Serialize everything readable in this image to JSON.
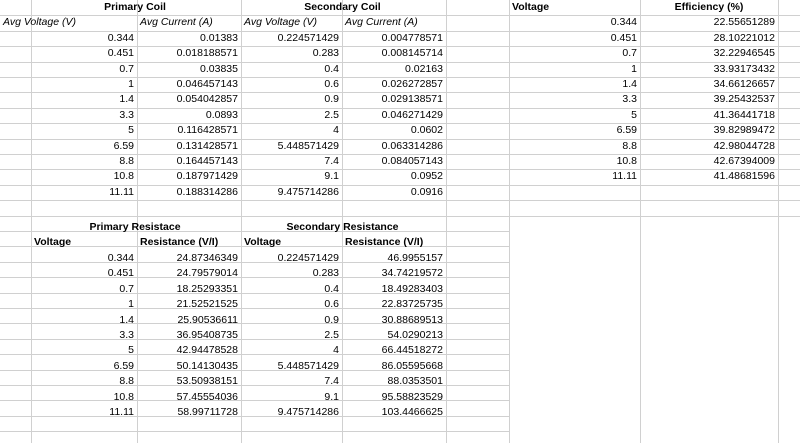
{
  "primary_coil": {
    "title": "Primary Coil",
    "col_voltage": "Avg Voltage (V)",
    "col_current": "Avg Current (A)",
    "rows": [
      [
        "0.344",
        "0.01383"
      ],
      [
        "0.451",
        "0.018188571"
      ],
      [
        "0.7",
        "0.03835"
      ],
      [
        "1",
        "0.046457143"
      ],
      [
        "1.4",
        "0.054042857"
      ],
      [
        "3.3",
        "0.0893"
      ],
      [
        "5",
        "0.116428571"
      ],
      [
        "6.59",
        "0.131428571"
      ],
      [
        "8.8",
        "0.164457143"
      ],
      [
        "10.8",
        "0.187971429"
      ],
      [
        "11.11",
        "0.188314286"
      ]
    ]
  },
  "secondary_coil": {
    "title": "Secondary Coil",
    "col_voltage": "Avg Voltage (V)",
    "col_current": "Avg Current (A)",
    "rows": [
      [
        "0.224571429",
        "0.004778571"
      ],
      [
        "0.283",
        "0.008145714"
      ],
      [
        "0.4",
        "0.02163"
      ],
      [
        "0.6",
        "0.026272857"
      ],
      [
        "0.9",
        "0.029138571"
      ],
      [
        "2.5",
        "0.046271429"
      ],
      [
        "4",
        "0.0602"
      ],
      [
        "5.448571429",
        "0.063314286"
      ],
      [
        "7.4",
        "0.084057143"
      ],
      [
        "9.1",
        "0.0952"
      ],
      [
        "9.475714286",
        "0.0916"
      ]
    ]
  },
  "efficiency": {
    "col_voltage": "Voltage",
    "col_efficiency": "Efficiency (%)",
    "rows": [
      [
        "0.344",
        "22.55651289"
      ],
      [
        "0.451",
        "28.10221012"
      ],
      [
        "0.7",
        "32.22946545"
      ],
      [
        "1",
        "33.93173432"
      ],
      [
        "1.4",
        "34.66126657"
      ],
      [
        "3.3",
        "39.25432537"
      ],
      [
        "5",
        "41.36441718"
      ],
      [
        "6.59",
        "39.82989472"
      ],
      [
        "8.8",
        "42.98044728"
      ],
      [
        "10.8",
        "42.67394009"
      ],
      [
        "11.11",
        "41.48681596"
      ]
    ]
  },
  "primary_resistance": {
    "title": "Primary Resistace",
    "col_voltage": "Voltage",
    "col_resistance": "Resistance (V/I)",
    "rows": [
      [
        "0.344",
        "24.87346349"
      ],
      [
        "0.451",
        "24.79579014"
      ],
      [
        "0.7",
        "18.25293351"
      ],
      [
        "1",
        "21.52521525"
      ],
      [
        "1.4",
        "25.90536611"
      ],
      [
        "3.3",
        "36.95408735"
      ],
      [
        "5",
        "42.94478528"
      ],
      [
        "6.59",
        "50.14130435"
      ],
      [
        "8.8",
        "53.50938151"
      ],
      [
        "10.8",
        "57.45554036"
      ],
      [
        "11.11",
        "58.99711728"
      ]
    ]
  },
  "secondary_resistance": {
    "title": "Secondary Resistance",
    "col_voltage": "Voltage",
    "col_resistance": "Resistance (V/I)",
    "rows": [
      [
        "0.224571429",
        "46.9955157"
      ],
      [
        "0.283",
        "34.74219572"
      ],
      [
        "0.4",
        "18.49283403"
      ],
      [
        "0.6",
        "22.83725735"
      ],
      [
        "0.9",
        "30.88689513"
      ],
      [
        "2.5",
        "54.0290213"
      ],
      [
        "4",
        "66.44518272"
      ],
      [
        "5.448571429",
        "86.05595668"
      ],
      [
        "7.4",
        "88.0353501"
      ],
      [
        "9.1",
        "95.58823529"
      ],
      [
        "9.475714286",
        "103.4466625"
      ]
    ]
  }
}
